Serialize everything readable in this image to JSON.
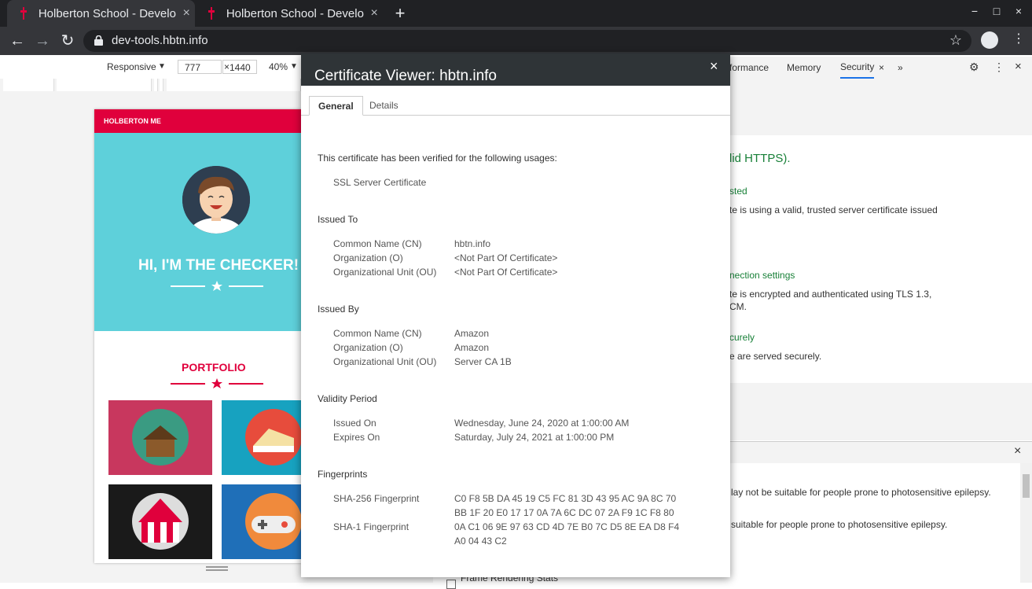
{
  "browser": {
    "tabs": [
      {
        "title": "Holberton School - Develo",
        "close": "×"
      },
      {
        "title": "Holberton School - Develo",
        "close": "×"
      }
    ],
    "new_tab": "+",
    "window": {
      "minimize": "−",
      "maximize": "□",
      "close": "×"
    },
    "url": "dev-tools.hbtn.info",
    "nav": {
      "back": "←",
      "forward": "→",
      "reload": "↻",
      "star": "☆",
      "menu": "⋮"
    }
  },
  "device_toolbar": {
    "mode": "Responsive",
    "width": "777",
    "times": "×",
    "height": "1440",
    "zoom": "40%"
  },
  "page": {
    "header": "HOLBERTON ME",
    "hero_title": "HI, I'M THE CHECKER!",
    "portfolio_title": "PORTFOLIO"
  },
  "devtools": {
    "tabs": [
      "formance",
      "Memory",
      "Security"
    ],
    "more": "»",
    "security": {
      "summary": "lid HTTPS).",
      "cert_heading": "sted",
      "cert_text": "te is using a valid, trusted server certificate issued",
      "conn_heading": "nection settings",
      "conn_text": "te is encrypted and authenticated using TLS 1.3,",
      "conn_text2": "CM.",
      "res_heading": "curely",
      "res_text": "e are served securely."
    },
    "drawer": {
      "line1": "lay not be suitable for people prone to photosensitive epilepsy.",
      "line2": "suitable for people prone to photosensitive epilepsy.",
      "frame_stats": "Frame Rendering Stats"
    }
  },
  "certificate": {
    "title": "Certificate Viewer: hbtn.info",
    "close": "×",
    "tabs": {
      "general": "General",
      "details": "Details"
    },
    "verified_text": "This certificate has been verified for the following usages:",
    "usage": "SSL Server Certificate",
    "issued_to": {
      "heading": "Issued To",
      "rows": [
        {
          "label": "Common Name (CN)",
          "value": "hbtn.info"
        },
        {
          "label": "Organization (O)",
          "value": "<Not Part Of Certificate>"
        },
        {
          "label": "Organizational Unit (OU)",
          "value": "<Not Part Of Certificate>"
        }
      ]
    },
    "issued_by": {
      "heading": "Issued By",
      "rows": [
        {
          "label": "Common Name (CN)",
          "value": "Amazon"
        },
        {
          "label": "Organization (O)",
          "value": "Amazon"
        },
        {
          "label": "Organizational Unit (OU)",
          "value": "Server CA 1B"
        }
      ]
    },
    "validity": {
      "heading": "Validity Period",
      "issued_on_label": "Issued On",
      "issued_on": "Wednesday, June 24, 2020 at 1:00:00 AM",
      "expires_on_label": "Expires On",
      "expires_on": "Saturday, July 24, 2021 at 1:00:00 PM"
    },
    "fingerprints": {
      "heading": "Fingerprints",
      "sha256_label": "SHA-256 Fingerprint",
      "sha256_line1": "C0 F8 5B DA 45 19 C5 FC 81 3D 43 95 AC 9A 8C 70",
      "sha256_line2": "BB 1F 20 E0 17 17 0A 7A 6C DC 07 2A F9 1C F8 80",
      "sha1_label": "SHA-1 Fingerprint",
      "sha1_line1": "0A C1 06 9E 97 63 CD 4D 7E B0 7C D5 8E EA D8 F4",
      "sha1_line2": "A0 04 43 C2"
    }
  }
}
